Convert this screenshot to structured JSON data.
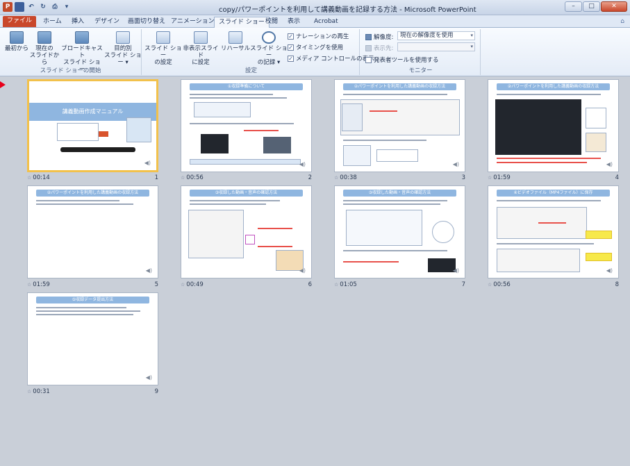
{
  "window": {
    "title": "copy/パワーポイントを利用して講義動画を記録する方法 - Microsoft PowerPoint",
    "controls": [
      "–",
      "□",
      "✕"
    ],
    "app_icon": "P"
  },
  "ribbon_tabs": [
    "ファイル",
    "ホーム",
    "挿入",
    "デザイン",
    "画面切り替え",
    "アニメーション",
    "スライド ショー",
    "校閲",
    "表示",
    "Acrobat"
  ],
  "active_tab": "スライド ショー",
  "ribbon": {
    "group1": {
      "label": "スライド ショーの開始",
      "buttons": [
        {
          "l1": "最初から",
          "l2": ""
        },
        {
          "l1": "現在の",
          "l2": "スライドから"
        },
        {
          "l1": "ブロードキャスト",
          "l2": "スライド ショー"
        },
        {
          "l1": "目的別",
          "l2": "スライド ショー ▾"
        }
      ]
    },
    "group2": {
      "label": "設定",
      "buttons": [
        {
          "l1": "スライド ショー",
          "l2": "の設定"
        },
        {
          "l1": "非表示スライド",
          "l2": "に設定"
        },
        {
          "l1": "リハーサル",
          "l2": ""
        },
        {
          "l1": "スライド ショー",
          "l2": "の記録 ▾"
        }
      ],
      "checks": [
        "ナレーションの再生",
        "タイミングを使用",
        "メディア コントロールの表示"
      ]
    },
    "group3": {
      "label": "モニター",
      "resolution_label": "解像度:",
      "resolution_value": "現在の解像度を使用",
      "show_on_label": "表示先:",
      "presenter_check": "発表者ツールを使用する"
    }
  },
  "slides": [
    {
      "num": "1",
      "time": "00:14",
      "title": "講義動画作成マニュアル"
    },
    {
      "num": "2",
      "time": "00:56",
      "title": "①収録準備について"
    },
    {
      "num": "3",
      "time": "00:38",
      "title": "②パワーポイントを利用した講義動画の収録方法"
    },
    {
      "num": "4",
      "time": "01:59",
      "title": "②パワーポイントを利用した講義動画の収録方法"
    },
    {
      "num": "5",
      "time": "01:59",
      "title": "②パワーポイントを利用した講義動画の収録方法"
    },
    {
      "num": "6",
      "time": "00:49",
      "title": "③収録した動画・音声の確認方法"
    },
    {
      "num": "7",
      "time": "01:05",
      "title": "③収録した動画・音声の確認方法"
    },
    {
      "num": "8",
      "time": "00:56",
      "title": "④ビデオファイル（MP4ファイル）に保存"
    },
    {
      "num": "9",
      "time": "00:31",
      "title": "⑤収録データ提出方法"
    }
  ],
  "colors": {
    "accent": "#c9472b",
    "slide_header": "#8fb6e0",
    "selection": "#f2c14b",
    "marker": "#e8001a"
  }
}
